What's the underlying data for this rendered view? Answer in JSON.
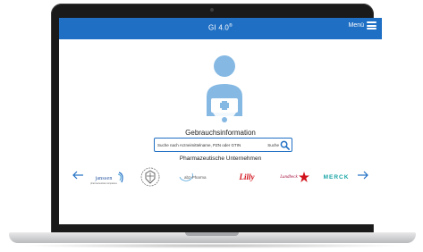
{
  "app": {
    "title": "GI 4.0",
    "title_mark": "®",
    "menu_label": "Menü",
    "accent_color": "#1f6fc4"
  },
  "hero": {
    "icon": "pharmacist-person-icon"
  },
  "main": {
    "section_title": "Gebrauchsinformation",
    "search": {
      "placeholder": "Suche nach Arzneimittelname, PZN oder GTIN",
      "value": "",
      "button_label": "Suche",
      "icon": "search-icon"
    },
    "subtitle": "Pharmazeutische Unternehmen"
  },
  "carousel": {
    "prev_icon": "arrow-left-icon",
    "next_icon": "arrow-right-icon",
    "logos": [
      {
        "name": "janssen",
        "text": "janssen",
        "subtext": "pharmaceutical companies"
      },
      {
        "name": "emblem-logo",
        "text": ""
      },
      {
        "name": "abz-pharma",
        "text": "abz-Pharma"
      },
      {
        "name": "lilly",
        "text": "Lilly"
      },
      {
        "name": "lundbeck",
        "text": "Lundbeck"
      },
      {
        "name": "merck",
        "text": "MERCK"
      }
    ]
  }
}
